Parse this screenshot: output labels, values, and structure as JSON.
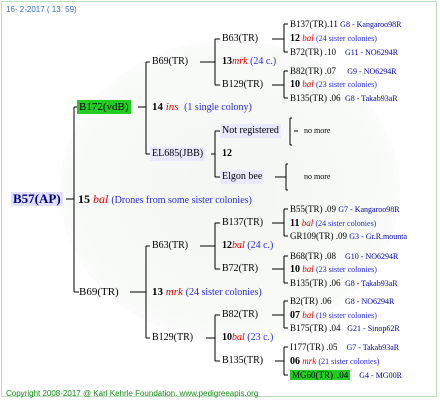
{
  "header": {
    "date": "16-  2-2017 ( 13: 59)"
  },
  "footer": {
    "copyright": "Copyright 2008-2017 @ Karl Kehrle Foundation.   www.pedigreeapis.org"
  },
  "root": {
    "id": "B57(AP)",
    "num": "15",
    "code": "bal",
    "note": "(Drones from some sister colonies)"
  },
  "gen1": {
    "top": {
      "id": "B172(vdB)",
      "num": "14",
      "code": "ins",
      "note": "(1 single colony)"
    },
    "bottom": {
      "id": "B69(TR)",
      "num": "13",
      "code": "mrk",
      "note": "(24 sister colonies)"
    }
  },
  "gen2": {
    "a": {
      "id": "B69(TR)",
      "num": "13",
      "code": "mrk",
      "note": "(24 c.)"
    },
    "b": {
      "id": "EL685(JBB)",
      "num": "12"
    },
    "c": {
      "id": "B63(TR)",
      "num": "12",
      "code": "bal",
      "note": "(24 c.)"
    },
    "d": {
      "id": "B129(TR)",
      "num": "10",
      "code": "bal",
      "note": "(23 c.)"
    }
  },
  "gen3": {
    "a1": {
      "id": "B63(TR)"
    },
    "a2": {
      "id": "B129(TR)"
    },
    "b1": {
      "id": "Not registered",
      "more": "no more"
    },
    "b2": {
      "id": "Elgon bee",
      "more": "no more"
    },
    "c1": {
      "id": "B137(TR)",
      "num": "11",
      "code": "bal",
      "note": "(24 sister colonies)"
    },
    "c2": {
      "id": "B72(TR)",
      "num": "10",
      "code": "bal",
      "note": "(23 sister colonies)"
    },
    "d1": {
      "id": "B82(TR)",
      "num": "07",
      "code": "bal",
      "note": "(19 sister colonies)"
    },
    "d2": {
      "id": "B135(TR)",
      "num": "06",
      "code": "mrk",
      "note": "(21 sister colonies)"
    }
  },
  "gen4": {
    "r1": {
      "id": "B137(TR)",
      "mid": ".11",
      "right": "G8 - Kangaroo98R"
    },
    "r1x": {
      "num": "12",
      "code": "bal",
      "note": "(24 sister colonies)"
    },
    "r2": {
      "id": "B72(TR)",
      "mid": ".10",
      "right": "G11 - NO6294R"
    },
    "r3": {
      "id": "B82(TR)",
      "mid": ".07",
      "right": "G9 - NO6294R"
    },
    "r3x": {
      "num": "10",
      "code": "bal",
      "note": "(23 sister colonies)"
    },
    "r4": {
      "id": "B135(TR)",
      "mid": ".06",
      "right": "G8 - Takab93aR"
    },
    "r5": {
      "id": "B55(TR)",
      "mid": ".09",
      "right": "G7 - Kangaroo98R"
    },
    "r6": {
      "id": "GR109(TR)",
      "mid": ".09",
      "right": "G3 - Gr.R.mounta"
    },
    "r7": {
      "id": "B68(TR)",
      "mid": ".08",
      "right": "G10 - NO6294R"
    },
    "r8": {
      "id": "B135(TR)",
      "mid": ".06",
      "right": "G8 - Takab93aR"
    },
    "r9": {
      "id": "B2(TR)",
      "mid": ".06",
      "right": "G8 - NO6294R"
    },
    "r10": {
      "id": "B175(TR)",
      "mid": ".04",
      "right": "G21 - Sinop62R"
    },
    "r11": {
      "id": "I177(TR)",
      "mid": ".05",
      "right": "G7 - Takab93aR"
    },
    "r12": {
      "id": "MG60(TR)",
      "mid": ".04",
      "right": "G4 - MG00R"
    }
  }
}
